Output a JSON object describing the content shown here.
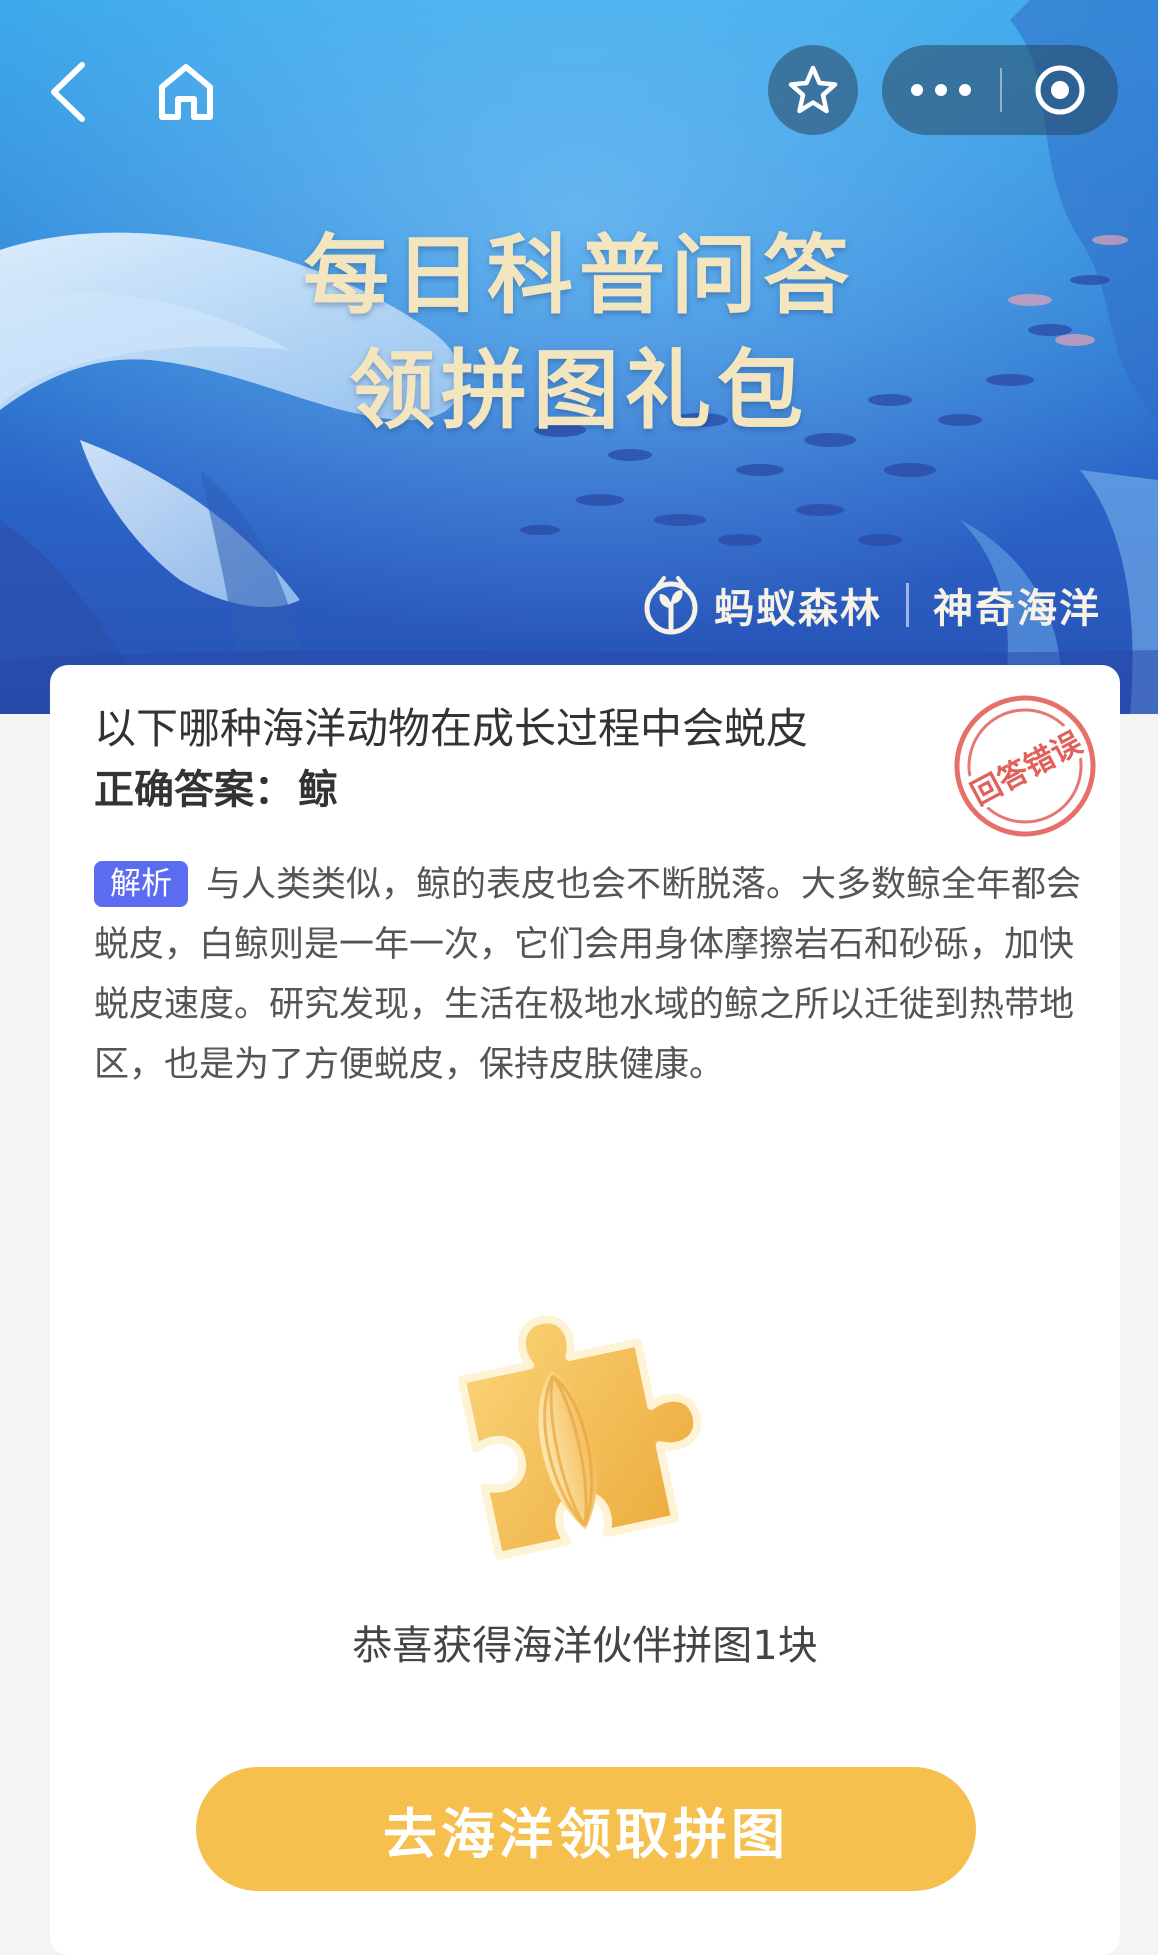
{
  "nav": {
    "back_icon": "chevron-left-icon",
    "home_icon": "home-icon",
    "favorite_icon": "star-icon",
    "more_icon": "more-dots-icon",
    "close_icon": "target-circle-icon"
  },
  "banner": {
    "title_line1": "每日科普问答",
    "title_line2": "领拼图礼包",
    "brand_primary": "蚂蚁森林",
    "brand_secondary": "神奇海洋"
  },
  "quiz": {
    "question": "以下哪种海洋动物在成长过程中会蜕皮",
    "answer_label": "正确答案：",
    "answer_value": "鲸",
    "stamp_text": "回答错误",
    "analysis_tag": "解析",
    "analysis_text": "与人类类似，鲸的表皮也会不断脱落。大多数鲸全年都会蜕皮，白鲸则是一年一次，它们会用身体摩擦岩石和砂砾，加快蜕皮速度。研究发现，生活在极地水域的鲸之所以迁徙到热带地区，也是为了方便蜕皮，保持皮肤健康。"
  },
  "reward": {
    "message": "恭喜获得海洋伙伴拼图1块",
    "button_label": "去海洋领取拼图"
  },
  "colors": {
    "accent": "#5b6cf0",
    "cta": "#f5c04e",
    "stamp": "#e2605a",
    "banner_title": "#f3e6bf"
  }
}
